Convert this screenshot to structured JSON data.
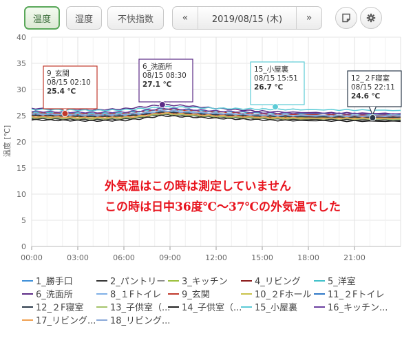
{
  "toolbar": {
    "tab_temperature": "温度",
    "tab_humidity": "湿度",
    "tab_discomfort": "不快指数",
    "prev_label": "«",
    "date_label": "2019/08/15 (木)",
    "next_label": "»",
    "note_icon": "note-icon",
    "settings_icon": "gear-icon"
  },
  "chart_data": {
    "type": "line",
    "ylabel": "温度 [℃]",
    "xlabel": "",
    "ylim": [
      0,
      40
    ],
    "y_ticks": [
      "0",
      "5",
      "10",
      "15",
      "20",
      "25",
      "30",
      "35",
      "40"
    ],
    "x_ticks": [
      "00:00",
      "03:00",
      "06:00",
      "09:00",
      "12:00",
      "15:00",
      "18:00",
      "21:00"
    ],
    "x_range_hours": [
      0,
      24
    ],
    "grid": true,
    "legend_placement": "bottom",
    "annotation_lines": [
      "外気温はこの時は測定していません",
      "この時は日中36度℃～37℃の外気温でした"
    ],
    "annotation_color": "#e8141e",
    "series": [
      {
        "name": "1_勝手口",
        "color": "#3e8fd8",
        "values": [
          25.2,
          25.1,
          25.0,
          25.1,
          25.3,
          25.6,
          25.8,
          25.6,
          25.3,
          25.1,
          24.9,
          24.9,
          24.8
        ]
      },
      {
        "name": "2_パントリー",
        "color": "#333333",
        "values": [
          24.4,
          24.3,
          24.2,
          24.3,
          24.6,
          25.0,
          25.2,
          25.0,
          24.7,
          24.5,
          24.3,
          24.2,
          24.1
        ]
      },
      {
        "name": "3_キッチン",
        "color": "#9bbf3a",
        "values": [
          24.9,
          24.8,
          24.7,
          24.8,
          25.0,
          25.4,
          25.6,
          25.4,
          25.1,
          24.9,
          24.7,
          24.6,
          24.5
        ]
      },
      {
        "name": "4_リビング",
        "color": "#8b1a1a",
        "values": [
          25.1,
          25.0,
          24.9,
          25.0,
          25.2,
          25.5,
          25.7,
          25.5,
          25.2,
          25.0,
          24.8,
          24.8,
          24.7
        ]
      },
      {
        "name": "5_洋室",
        "color": "#3fc0c9",
        "values": [
          25.6,
          25.5,
          25.4,
          25.5,
          25.8,
          26.1,
          26.3,
          26.1,
          25.8,
          25.6,
          25.4,
          25.3,
          25.2
        ]
      },
      {
        "name": "6_洗面所",
        "color": "#5b2a86",
        "values": [
          26.4,
          26.2,
          26.1,
          26.3,
          26.6,
          26.9,
          27.1,
          26.9,
          26.4,
          26.0,
          25.7,
          25.5,
          25.4
        ]
      },
      {
        "name": "8_１Fトイレ",
        "color": "#7fb0e6",
        "values": [
          25.3,
          25.2,
          25.1,
          25.2,
          25.4,
          25.7,
          25.9,
          25.7,
          25.4,
          25.2,
          25.0,
          24.9,
          24.9
        ]
      },
      {
        "name": "9_玄関",
        "color": "#c0392b",
        "values": [
          25.5,
          25.4,
          25.3,
          25.4,
          25.7,
          26.0,
          26.2,
          26.0,
          25.7,
          25.4,
          25.2,
          25.1,
          25.0
        ]
      },
      {
        "name": "10_２Fホール",
        "color": "#c9c24a",
        "values": [
          25.0,
          24.9,
          24.8,
          24.9,
          25.1,
          25.4,
          25.6,
          25.4,
          25.1,
          24.9,
          24.7,
          24.7,
          24.6
        ]
      },
      {
        "name": "11_２Fトイレ",
        "color": "#2e78c7",
        "values": [
          24.7,
          24.6,
          24.5,
          24.6,
          24.8,
          25.2,
          25.4,
          25.2,
          24.9,
          24.7,
          24.5,
          24.4,
          24.3
        ]
      },
      {
        "name": "12_２F寝室",
        "color": "#2b3a4a",
        "values": [
          25.0,
          24.9,
          24.8,
          24.9,
          25.1,
          25.4,
          25.6,
          25.4,
          25.1,
          24.9,
          24.8,
          24.7,
          24.6
        ]
      },
      {
        "name": "13_子供室（...",
        "color": "#a5c46a",
        "values": [
          24.6,
          24.5,
          24.4,
          24.5,
          24.7,
          25.1,
          25.3,
          25.1,
          24.8,
          24.6,
          24.4,
          24.4,
          24.3
        ]
      },
      {
        "name": "14_子供室（...",
        "color": "#222222",
        "values": [
          24.2,
          24.1,
          24.0,
          24.1,
          24.4,
          24.8,
          25.0,
          24.8,
          24.5,
          24.3,
          24.1,
          24.0,
          23.9
        ]
      },
      {
        "name": "15_小屋裏",
        "color": "#5ccbd6",
        "values": [
          26.2,
          26.1,
          26.0,
          26.1,
          26.3,
          26.5,
          26.7,
          26.6,
          26.4,
          26.3,
          26.2,
          26.1,
          26.0
        ]
      },
      {
        "name": "16_キッチン...",
        "color": "#6b3fa0",
        "values": [
          25.8,
          25.7,
          25.6,
          25.7,
          25.9,
          26.2,
          26.4,
          26.2,
          25.9,
          25.7,
          25.5,
          25.4,
          25.3
        ]
      },
      {
        "name": "17_リビング...",
        "color": "#f0a050",
        "values": [
          24.8,
          24.7,
          24.6,
          24.7,
          24.9,
          25.3,
          25.5,
          25.3,
          25.0,
          24.8,
          24.6,
          24.5,
          24.5
        ]
      },
      {
        "name": "18_リビング...",
        "color": "#8aa8d8",
        "values": [
          25.4,
          25.3,
          25.2,
          25.3,
          25.5,
          25.8,
          26.0,
          25.8,
          25.5,
          25.3,
          25.1,
          25.0,
          25.0
        ]
      }
    ],
    "x_hours": [
      0,
      2,
      4,
      6,
      7,
      8,
      8.5,
      10,
      12,
      14,
      16,
      20,
      24
    ],
    "tooltips": [
      {
        "series": "9_玄関",
        "time": "08/15 02:10",
        "value": "25.4 ℃",
        "hour": 2.17,
        "temp": 25.4,
        "color": "#c0392b"
      },
      {
        "series": "6_洗面所",
        "time": "08/15 08:30",
        "value": "27.1 ℃",
        "hour": 8.5,
        "temp": 27.1,
        "color": "#5b2a86"
      },
      {
        "series": "15_小屋裏",
        "time": "08/15 15:51",
        "value": "26.7 ℃",
        "hour": 15.85,
        "temp": 26.7,
        "color": "#5ccbd6"
      },
      {
        "series": "12_２F寝室",
        "time": "08/15 22:11",
        "value": "24.6 ℃",
        "hour": 22.18,
        "temp": 24.6,
        "color": "#2b3a4a"
      }
    ]
  }
}
